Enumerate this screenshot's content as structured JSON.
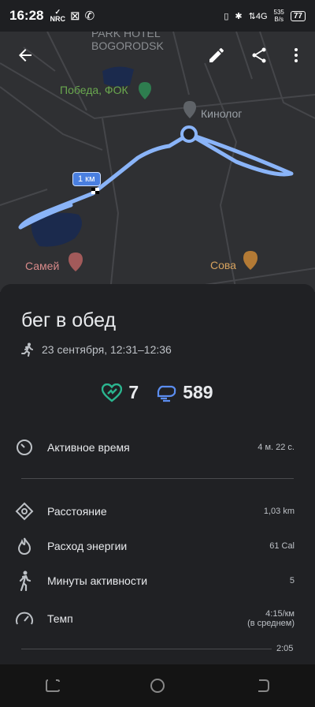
{
  "status_bar": {
    "time": "16:28",
    "nrc": "NRC",
    "net": "4G",
    "speed_value": "535",
    "speed_unit": "B/s",
    "battery": "77"
  },
  "map": {
    "labels": {
      "park_hotel": "PARK HOTEL BOGORODSK",
      "pobeda": "Победа, ФОК",
      "kinolog": "Кинолог",
      "samey": "Самей",
      "sova": "Сова"
    },
    "km_marker": "1 км"
  },
  "activity": {
    "title": "бег в обед",
    "date": "23 сентября, 12:31–12:36",
    "heart_points": "7",
    "steps": "589"
  },
  "metrics": {
    "active_time": {
      "label": "Активное время",
      "value": "4 м. 22 с."
    },
    "distance": {
      "label": "Расстояние",
      "value": "1,03 km"
    },
    "energy": {
      "label": "Расход энергии",
      "value": "61 Cal"
    },
    "move_minutes": {
      "label": "Минуты активности",
      "value": "5"
    },
    "pace": {
      "label": "Темп",
      "value": "4:15/км",
      "note": "(в среднем)"
    }
  },
  "chart_hint": "2:05",
  "colors": {
    "route": "#8ab4f8",
    "heart": "#2bb58f",
    "accent": "#4a7fe0"
  }
}
